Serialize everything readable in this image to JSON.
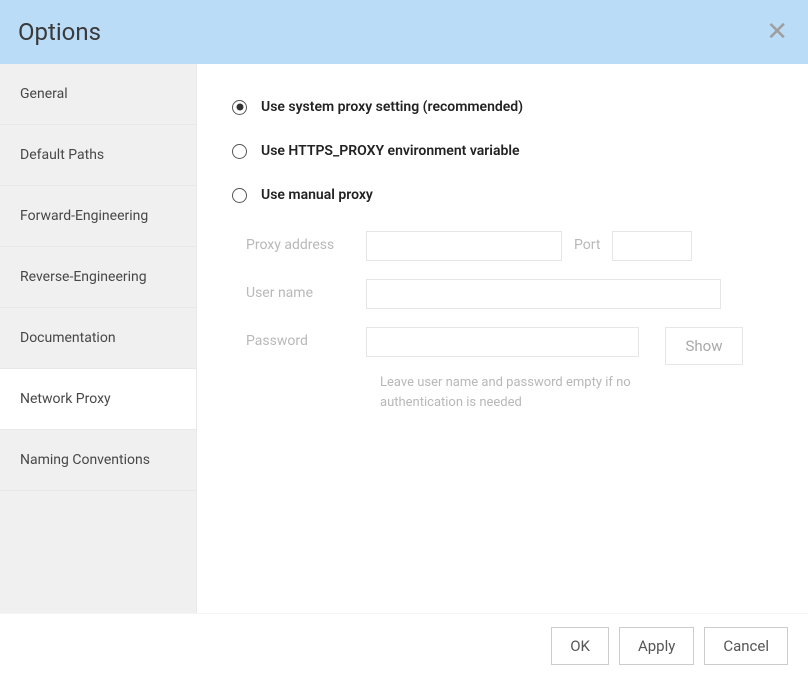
{
  "header": {
    "title": "Options"
  },
  "sidebar": {
    "items": [
      {
        "label": "General",
        "active": false
      },
      {
        "label": "Default Paths",
        "active": false
      },
      {
        "label": "Forward-Engineering",
        "active": false
      },
      {
        "label": "Reverse-Engineering",
        "active": false
      },
      {
        "label": "Documentation",
        "active": false
      },
      {
        "label": "Network Proxy",
        "active": true
      },
      {
        "label": "Naming Conventions",
        "active": false
      }
    ]
  },
  "proxy": {
    "options": [
      {
        "label": "Use system proxy setting (recommended)",
        "checked": true
      },
      {
        "label": "Use HTTPS_PROXY environment variable",
        "checked": false
      },
      {
        "label": "Use manual proxy",
        "checked": false
      }
    ],
    "fields": {
      "address_label": "Proxy address",
      "address_value": "",
      "port_label": "Port",
      "port_value": "",
      "username_label": "User name",
      "username_value": "",
      "password_label": "Password",
      "password_value": "",
      "show_button": "Show",
      "helper_text": "Leave user name and password empty if no authentication is needed"
    }
  },
  "footer": {
    "ok": "OK",
    "apply": "Apply",
    "cancel": "Cancel"
  }
}
